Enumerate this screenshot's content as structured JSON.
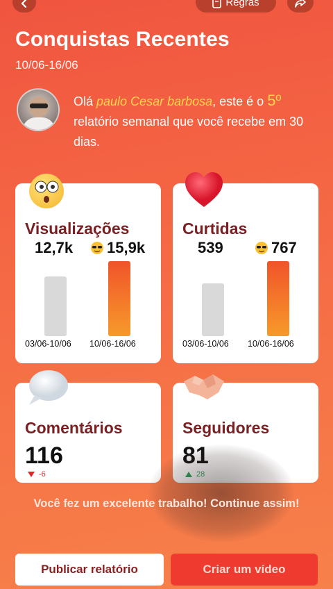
{
  "header": {
    "back_icon": "chevron-left-icon",
    "rules_label": "Regras",
    "rules_icon": "document-icon",
    "share_icon": "share-icon"
  },
  "page": {
    "title": "Conquistas Recentes",
    "date_range": "10/06-16/06"
  },
  "greeting": {
    "prefix": "Olá ",
    "user_name": "paulo Cesar barbosa",
    "mid": ", este é o ",
    "report_number": "5º",
    "suffix": " relatório semanal que você recebe em 30 dias."
  },
  "cards": {
    "views": {
      "title": "Visualizações",
      "previous_value": "12,7k",
      "current_value": "15,9k",
      "previous_label": "03/06-10/06",
      "current_label": "10/06-16/06",
      "current_fraction": 1.0,
      "previous_fraction": 0.8,
      "icon": "surprised-face-icon",
      "badge_icon": "sunglasses-face-icon"
    },
    "likes": {
      "title": "Curtidas",
      "previous_value": "539",
      "current_value": "767",
      "previous_label": "03/06-10/06",
      "current_label": "10/06-16/06",
      "current_fraction": 1.0,
      "previous_fraction": 0.7,
      "icon": "heart-icon",
      "badge_icon": "sunglasses-face-icon"
    },
    "comments": {
      "title": "Comentários",
      "value": "116",
      "delta": "-6",
      "trend": "down",
      "icon": "speech-bubble-icon"
    },
    "followers": {
      "title": "Seguidores",
      "value": "81",
      "delta": "28",
      "trend": "up",
      "icon": "handshake-icon"
    }
  },
  "footer": {
    "message": "Você fez um excelente trabalho! Continue assim!",
    "publish_label": "Publicar relatório",
    "video_label": "Criar um vídeo"
  },
  "colors": {
    "background_top": "#f0553f",
    "accent_yellow": "#ffd54a",
    "bar_current": "#f0542a",
    "bar_previous": "#d9d9d9",
    "title_dark_red": "#7a1f22",
    "down_red": "#e0242a",
    "up_green": "#2fa35a",
    "video_button": "#ef3b2f"
  }
}
